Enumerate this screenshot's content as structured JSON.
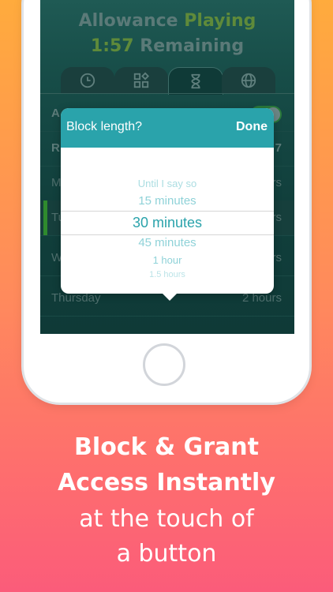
{
  "app": {
    "allowance_word": "Allowance",
    "playing_word": "Playing",
    "time_remaining": "1:57",
    "remaining_word": "Remaining",
    "tab_icons": [
      "clock-icon",
      "apps-icon",
      "hourglass-icon",
      "globe-icon"
    ],
    "rows": [
      {
        "label": "A",
        "value": ""
      },
      {
        "label": "R",
        "value": "7"
      },
      {
        "label": "M",
        "value": "rs"
      },
      {
        "label": "Tu",
        "value": "rs"
      },
      {
        "label": "W",
        "value": "rs"
      },
      {
        "label": "Thursday",
        "value": "2 hours"
      }
    ]
  },
  "dialog": {
    "title": "Block length?",
    "done_label": "Done",
    "options": [
      "Until I say so",
      "15 minutes",
      "30 minutes",
      "45 minutes",
      "1 hour",
      "1.5 hours"
    ],
    "selected": "30 minutes"
  },
  "promo": {
    "line1": "Block & Grant",
    "line2": "Access Instantly",
    "line3": "at the touch of",
    "line4": "a button"
  },
  "colors": {
    "accent": "#2aa3ab",
    "active_green": "#2f8a2e",
    "bg_top": "#ffab3d",
    "bg_bottom": "#fb5c7a"
  }
}
